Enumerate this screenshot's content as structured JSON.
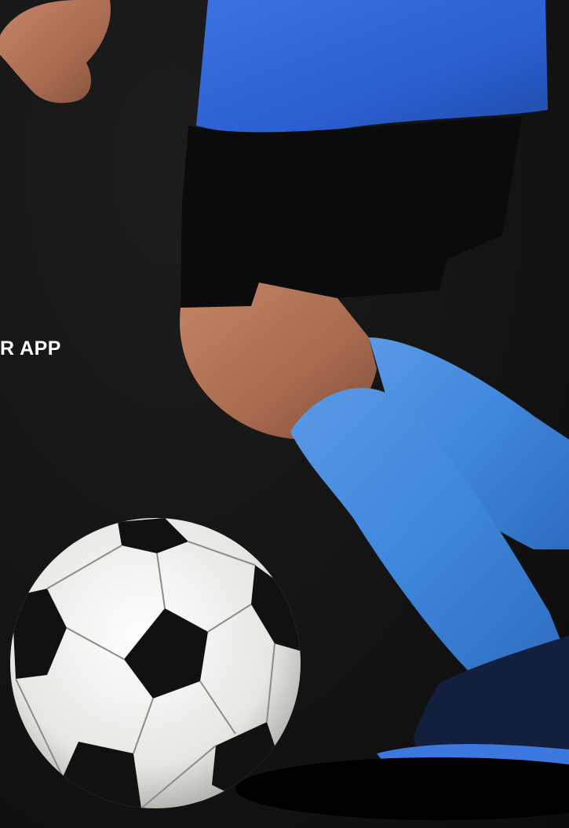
{
  "headline": {
    "text": "R APP"
  },
  "colors": {
    "background": "#121212",
    "jersey": "#2f62d6",
    "socks": "#3f86dc",
    "shorts": "#0b0b0b",
    "skin": "#b77558",
    "ball_white": "#ededec",
    "ball_black": "#111111"
  }
}
